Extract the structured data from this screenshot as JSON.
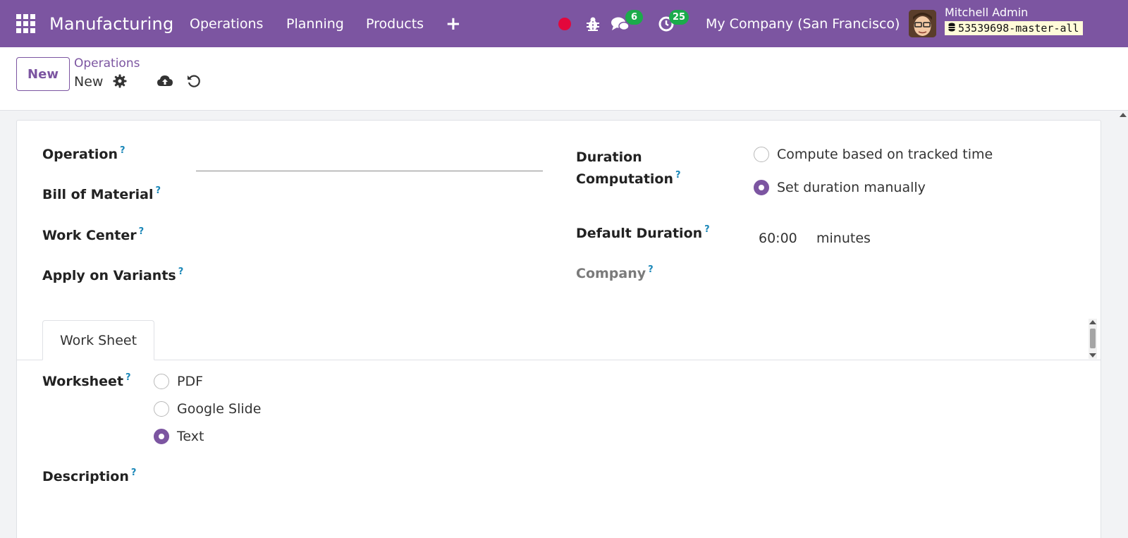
{
  "navbar": {
    "app_title": "Manufacturing",
    "menu": [
      "Operations",
      "Planning",
      "Products"
    ],
    "plus": "+",
    "chat_badge": "6",
    "activity_badge": "25",
    "company": "My Company (San Francisco)",
    "user_name": "Mitchell Admin",
    "db_name": "53539698-master-all",
    "colors": {
      "brand": "#7c55a1",
      "badge": "#1bab4b",
      "record": "#e3073c"
    },
    "icons": [
      "apps-grid-icon",
      "record-icon",
      "bug-icon",
      "chat-icon",
      "activity-clock-icon",
      "database-icon"
    ]
  },
  "control_panel": {
    "new_button": "New",
    "breadcrumb": "Operations",
    "record_name": "New",
    "icons": [
      "gear-icon",
      "cloud-upload-icon",
      "undo-icon"
    ]
  },
  "form": {
    "operation_label": "Operation",
    "operation_value": "",
    "bom_label": "Bill of Material",
    "work_center_label": "Work Center",
    "variants_label": "Apply on Variants",
    "duration_computation_label_1": "Duration",
    "duration_computation_label_2": "Computation",
    "duration_options": [
      {
        "label": "Compute based on tracked time",
        "checked": false
      },
      {
        "label": "Set duration manually",
        "checked": true
      }
    ],
    "default_duration_label": "Default Duration",
    "default_duration_value": "60:00",
    "default_duration_unit": "minutes",
    "company_label": "Company",
    "help_mark": "?"
  },
  "tabs": {
    "work_sheet": "Work Sheet"
  },
  "worksheet": {
    "label": "Worksheet",
    "options": [
      {
        "label": "PDF",
        "checked": false
      },
      {
        "label": "Google Slide",
        "checked": false
      },
      {
        "label": "Text",
        "checked": true
      }
    ],
    "description_label": "Description"
  }
}
